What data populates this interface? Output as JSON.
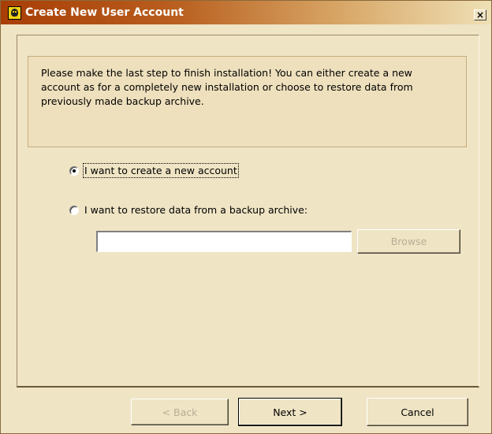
{
  "window": {
    "title": "Create New User Account",
    "close_label": "×"
  },
  "info": {
    "text": "Please make the last step to finish installation! You can either create a new\naccount as for a completely new installation or choose to restore data from\npreviously made backup archive."
  },
  "options": {
    "create_new": {
      "label": "I want to create a new account",
      "selected": true
    },
    "restore": {
      "label": "I want to restore data from a backup archive:",
      "selected": false
    }
  },
  "backup_path": {
    "value": ""
  },
  "buttons": {
    "browse": "Browse",
    "back": "< Back",
    "next": "Next >",
    "cancel": "Cancel"
  },
  "colors": {
    "title_gradient_start": "#a83e06",
    "title_gradient_end": "#efe0b6",
    "window_background": "#efe4c4",
    "disabled_text": "#b9ae94"
  },
  "icons": {
    "app": "app-icon",
    "close": "close-icon"
  }
}
